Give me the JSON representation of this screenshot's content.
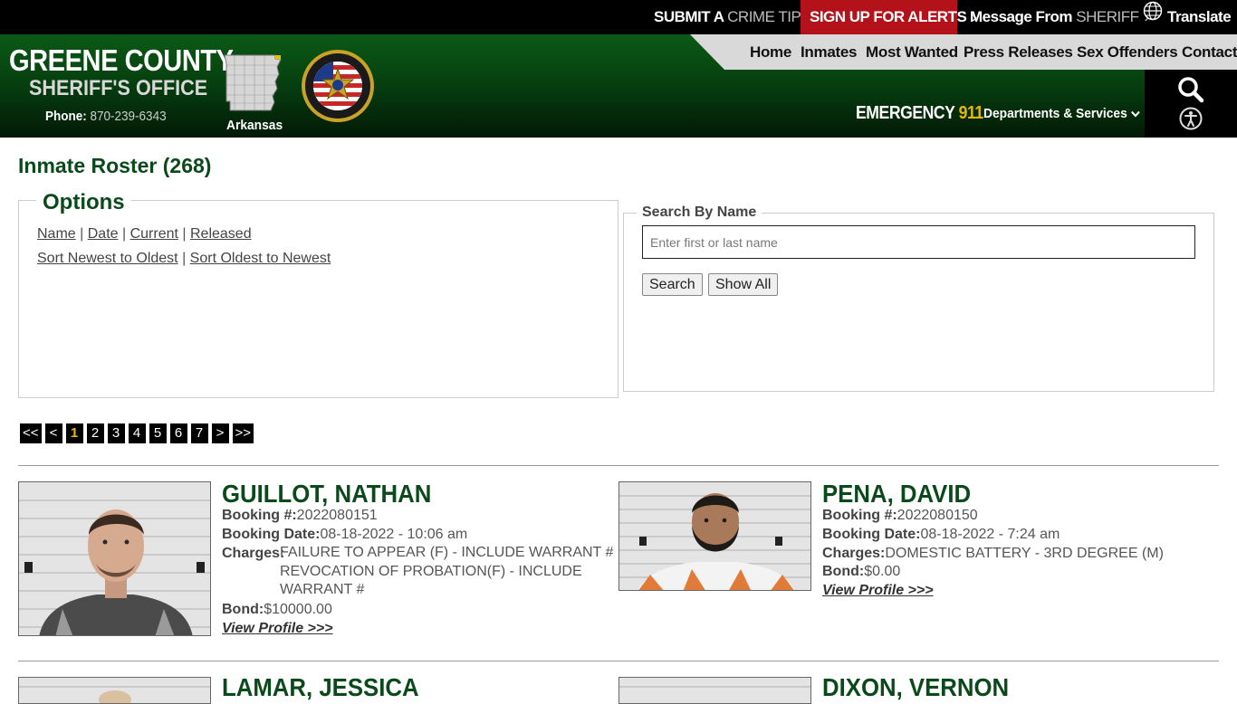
{
  "topbar": {
    "tip_a": "SUBMIT A",
    "tip_b": "CRIME TIP",
    "alerts": "SIGN UP FOR ALERTS",
    "msg_a": "Message From",
    "msg_b": "SHERIFF",
    "translate": "Translate"
  },
  "header": {
    "county": "GREENE COUNTY",
    "office": "SHERIFF'S OFFICE",
    "phone_label": "Phone:",
    "phone_number": "870-239-6343",
    "state": "Arkansas",
    "nav": [
      "Home",
      "Inmates",
      "Most Wanted",
      "Press Releases",
      "Sex Offenders",
      "Contact"
    ],
    "emergency_label": "EMERGENCY",
    "emergency_number": "911",
    "departments": "Departments & Services"
  },
  "roster": {
    "title": "Inmate Roster (268)",
    "options_legend": "Options",
    "filter_links": [
      "Name",
      "Date",
      "Current",
      "Released"
    ],
    "sort_links": [
      "Sort Newest to Oldest",
      "Sort Oldest to Newest"
    ],
    "search_legend": "Search By Name",
    "search_placeholder": "Enter first or last name",
    "search_button": "Search",
    "show_all_button": "Show All",
    "pager": [
      "<<",
      "<",
      "1",
      "2",
      "3",
      "4",
      "5",
      "6",
      "7",
      ">",
      ">>"
    ],
    "current_page": "1"
  },
  "labels": {
    "booking_no": "Booking #:",
    "booking_date": "Booking Date:",
    "charges": "Charges:",
    "bond": "Bond:",
    "view_profile": "View Profile >>>"
  },
  "inmates": [
    {
      "name": "GUILLOT, NATHAN",
      "booking_no": "2022080151",
      "booking_date": "08-18-2022 - 10:06 am",
      "charges": [
        "FAILURE TO APPEAR (F) - INCLUDE WARRANT #",
        "REVOCATION OF PROBATION(F) - INCLUDE",
        "WARRANT #"
      ],
      "bond": "$10000.00"
    },
    {
      "name": "PENA, DAVID",
      "booking_no": "2022080150",
      "booking_date": "08-18-2022 - 7:24 am",
      "charges": [
        "DOMESTIC BATTERY - 3RD DEGREE (M)"
      ],
      "bond": "$0.00"
    },
    {
      "name": "LAMAR, JESSICA"
    },
    {
      "name": "DIXON, VERNON"
    }
  ]
}
